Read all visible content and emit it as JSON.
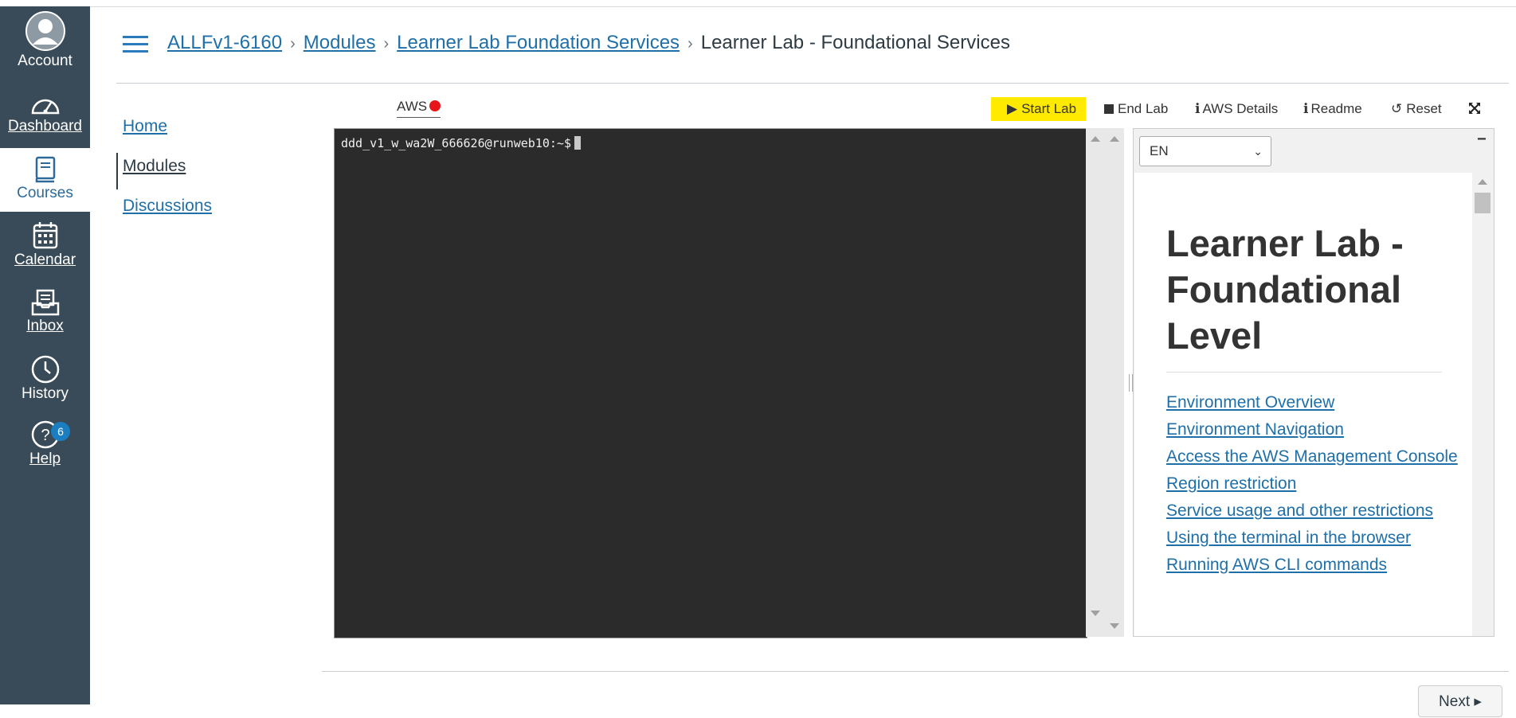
{
  "global_nav": {
    "account": "Account",
    "dashboard": "Dashboard",
    "courses": "Courses",
    "calendar": "Calendar",
    "inbox": "Inbox",
    "history": "History",
    "help": "Help",
    "help_badge": "6"
  },
  "breadcrumb": {
    "course": "ALLFv1-6160",
    "modules": "Modules",
    "module_item": "Learner Lab Foundation Services",
    "current": "Learner Lab - Foundational Services"
  },
  "course_nav": {
    "home": "Home",
    "modules": "Modules",
    "discussions": "Discussions"
  },
  "lab_toolbar": {
    "aws_label": "AWS",
    "aws_status_color": "#e8141b",
    "start_lab": "Start Lab",
    "end_lab": "End Lab",
    "aws_details": "AWS Details",
    "readme": "Readme",
    "reset": "Reset"
  },
  "terminal": {
    "prompt": "ddd_v1_w_wa2W_666626@runweb10:~$"
  },
  "readme_panel": {
    "language": "EN",
    "title": "Learner Lab - Foundational Level",
    "toc": [
      "Environment Overview",
      "Environment Navigation",
      "Access the AWS Management Console",
      "Region restriction",
      "Service usage and other restrictions",
      "Using the terminal in the browser",
      "Running AWS CLI commands"
    ]
  },
  "footer": {
    "next": "Next ▸"
  }
}
